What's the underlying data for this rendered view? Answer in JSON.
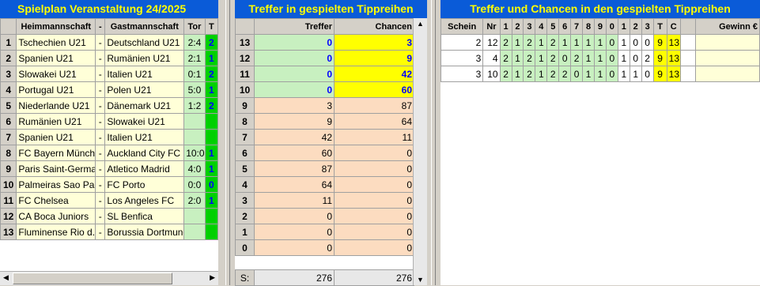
{
  "left": {
    "title": "Spielplan Veranstaltung 24/2025",
    "headers": {
      "home": "Heimmannschaft",
      "dash": "-",
      "away": "Gastmannschaft",
      "goals": "Tor",
      "t": "T"
    },
    "rows": [
      {
        "n": "1",
        "home": "Tschechien U21",
        "away": "Deutschland U21",
        "score": "2:4",
        "t": "2"
      },
      {
        "n": "2",
        "home": "Spanien U21",
        "away": "Rumänien U21",
        "score": "2:1",
        "t": "1"
      },
      {
        "n": "3",
        "home": "Slowakei U21",
        "away": "Italien U21",
        "score": "0:1",
        "t": "2"
      },
      {
        "n": "4",
        "home": "Portugal U21",
        "away": "Polen U21",
        "score": "5:0",
        "t": "1"
      },
      {
        "n": "5",
        "home": "Niederlande U21",
        "away": "Dänemark U21",
        "score": "1:2",
        "t": "2"
      },
      {
        "n": "6",
        "home": "Rumänien U21",
        "away": "Slowakei U21",
        "score": "",
        "t": ""
      },
      {
        "n": "7",
        "home": "Spanien U21",
        "away": "Italien U21",
        "score": "",
        "t": ""
      },
      {
        "n": "8",
        "home": "FC Bayern Münch...",
        "away": "Auckland City FC",
        "score": "10:0",
        "t": "1"
      },
      {
        "n": "9",
        "home": "Paris Saint-Germain",
        "away": "Atletico Madrid",
        "score": "4:0",
        "t": "1"
      },
      {
        "n": "10",
        "home": "Palmeiras Sao Pa...",
        "away": "FC Porto",
        "score": "0:0",
        "t": "0"
      },
      {
        "n": "11",
        "home": "FC Chelsea",
        "away": "Los Angeles FC",
        "score": "2:0",
        "t": "1"
      },
      {
        "n": "12",
        "home": "CA Boca Juniors",
        "away": "SL Benfica",
        "score": "",
        "t": ""
      },
      {
        "n": "13",
        "home": "Fluminense Rio d...",
        "away": "Borussia Dortmund",
        "score": "",
        "t": ""
      }
    ],
    "dash": "-"
  },
  "middle": {
    "title": "Treffer in gespielten Tippreihen",
    "headers": {
      "treffer": "Treffer",
      "chancen": "Chancen"
    },
    "rows": [
      {
        "n": "13",
        "treffer": "0",
        "chancen": "3"
      },
      {
        "n": "12",
        "treffer": "0",
        "chancen": "9"
      },
      {
        "n": "11",
        "treffer": "0",
        "chancen": "42"
      },
      {
        "n": "10",
        "treffer": "0",
        "chancen": "60"
      },
      {
        "n": "9",
        "treffer": "3",
        "chancen": "87"
      },
      {
        "n": "8",
        "treffer": "9",
        "chancen": "64"
      },
      {
        "n": "7",
        "treffer": "42",
        "chancen": "11"
      },
      {
        "n": "6",
        "treffer": "60",
        "chancen": "0"
      },
      {
        "n": "5",
        "treffer": "87",
        "chancen": "0"
      },
      {
        "n": "4",
        "treffer": "64",
        "chancen": "0"
      },
      {
        "n": "3",
        "treffer": "11",
        "chancen": "0"
      },
      {
        "n": "2",
        "treffer": "0",
        "chancen": "0"
      },
      {
        "n": "1",
        "treffer": "0",
        "chancen": "0"
      },
      {
        "n": "0",
        "treffer": "0",
        "chancen": "0"
      }
    ],
    "sum": {
      "label": "S:",
      "treffer": "276",
      "chancen": "276"
    }
  },
  "right": {
    "title": "Treffer und Chancen in den gespielten Tippreihen",
    "headers": [
      "Schein",
      "Nr",
      "1",
      "2",
      "3",
      "4",
      "5",
      "6",
      "7",
      "8",
      "9",
      "0",
      "1",
      "2",
      "3",
      "T",
      "C",
      "Gewinn €"
    ],
    "rows": [
      {
        "schein": "2",
        "nr": "12",
        "tips": [
          "2",
          "1",
          "2",
          "1",
          "2",
          "1",
          "1",
          "1",
          "1",
          "0",
          "1",
          "0",
          "0"
        ],
        "t": "9",
        "c": "13"
      },
      {
        "schein": "3",
        "nr": "4",
        "tips": [
          "2",
          "1",
          "2",
          "1",
          "2",
          "0",
          "2",
          "1",
          "1",
          "0",
          "1",
          "0",
          "2"
        ],
        "t": "9",
        "c": "13"
      },
      {
        "schein": "3",
        "nr": "10",
        "tips": [
          "2",
          "1",
          "2",
          "1",
          "2",
          "2",
          "0",
          "1",
          "1",
          "0",
          "1",
          "1",
          "0"
        ],
        "t": "9",
        "c": "13"
      }
    ]
  },
  "colors": {
    "titlebar": "#0a5bd8",
    "title_text": "#ffff00",
    "green_cell": "#c8f0c0",
    "peach_cell": "#fcdcc0",
    "yellow_cell": "#ffff00",
    "bright_green": "#00d000"
  }
}
